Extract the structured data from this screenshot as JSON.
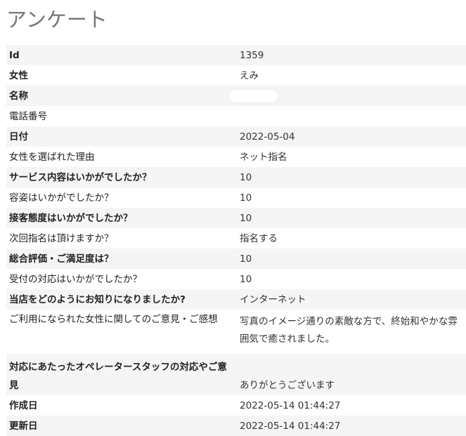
{
  "page": {
    "title": "アンケート"
  },
  "rows": [
    {
      "label": "Id",
      "value": "1359"
    },
    {
      "label": "女性",
      "value": "えみ"
    },
    {
      "label": "名称",
      "value": ""
    },
    {
      "label": "電話番号",
      "value": ""
    },
    {
      "label": "日付",
      "value": "2022-05-04"
    },
    {
      "label": "女性を選ばれた理由",
      "value": "ネット指名"
    },
    {
      "label": "サービス内容はいかがでしたか？",
      "value": "10"
    },
    {
      "label": "容姿はいかがでしたか？",
      "value": "10"
    },
    {
      "label": "接客態度はいかがでしたか？",
      "value": "10"
    },
    {
      "label": "次回指名は頂けますか？",
      "value": "指名する"
    },
    {
      "label": "総合評価・ご満足度は？",
      "value": "10"
    },
    {
      "label": "受付の対応はいかがでしたか？",
      "value": "10"
    },
    {
      "label": "当店をどのようにお知りになりましたか?",
      "value": "インターネット"
    },
    {
      "label": "ご利用になられた女性に関してのご意見・ご感想",
      "value": "写真のイメージ通りの素敵な方で、終始和やかな雰囲気で癒されました。"
    },
    {
      "label_line1": "対応にあたったオペレータースタッフの対応やご意",
      "label_line2": "見",
      "value": "ありがとうございます"
    },
    {
      "label": "作成日",
      "value": "2022-05-14 01:44:27"
    },
    {
      "label": "更新日",
      "value": "2022-05-14 01:44:27"
    }
  ]
}
